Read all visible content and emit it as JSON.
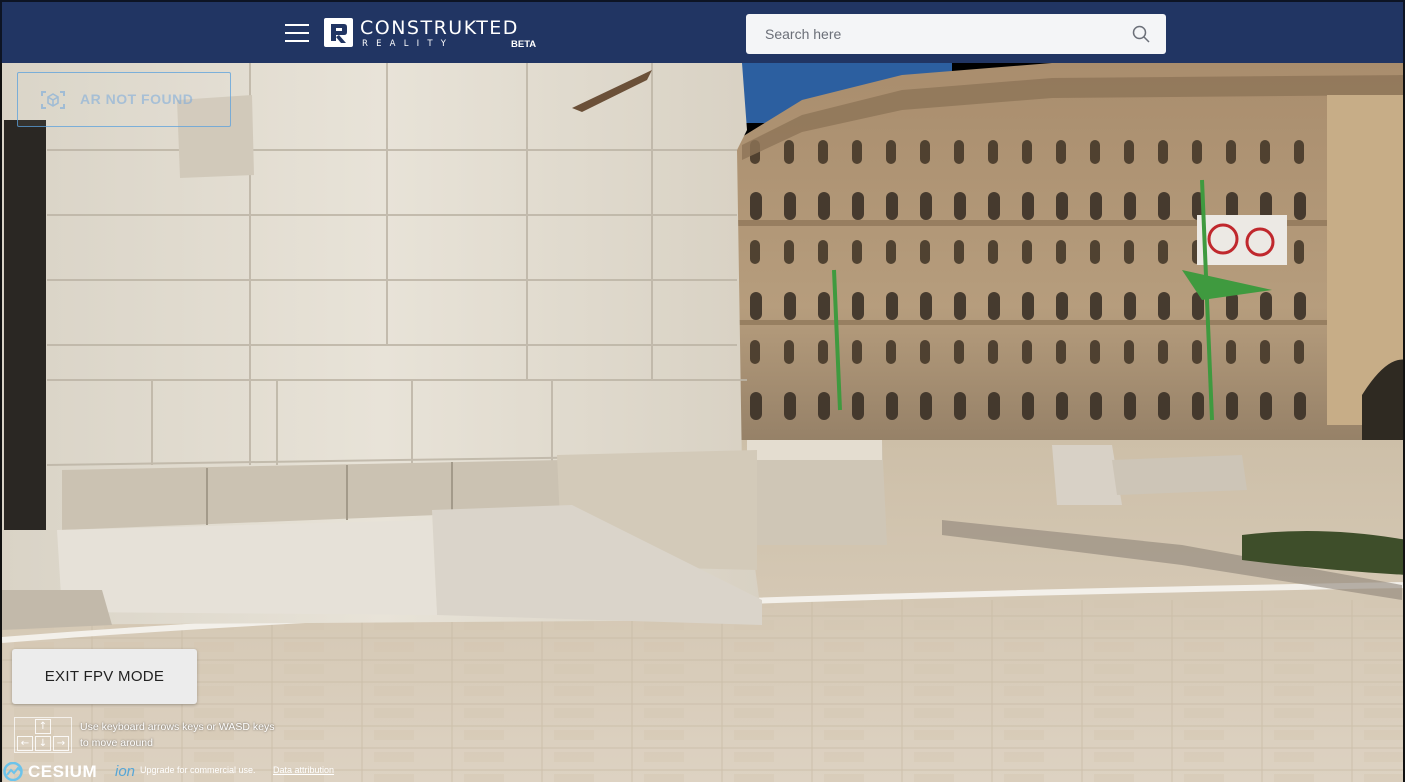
{
  "header": {
    "logo": {
      "word": "CONSTRUKTED",
      "sub": "REALITY",
      "badge": "BETA"
    },
    "search": {
      "placeholder": "Search here",
      "value": ""
    }
  },
  "overlay": {
    "ar_button_label": "AR NOT FOUND",
    "exit_button_label": "EXIT FPV MODE",
    "keys": {
      "up": "↑",
      "left": "←",
      "down": "↓",
      "right": "→"
    },
    "hint_text": "Use keyboard arrows keys or WASD keys to move around"
  },
  "footer": {
    "cesium_word": "CESIUM",
    "cesium_ion": "ion",
    "upgrade_text": "Upgrade for commercial use.",
    "attribution_link": "Data attribution"
  },
  "colors": {
    "topbar": "#213563",
    "sky": "#2c5fa0",
    "stone_light": "#e2dccf",
    "palace_stone": "#b39a79",
    "pavement": "#d7cbb8"
  }
}
